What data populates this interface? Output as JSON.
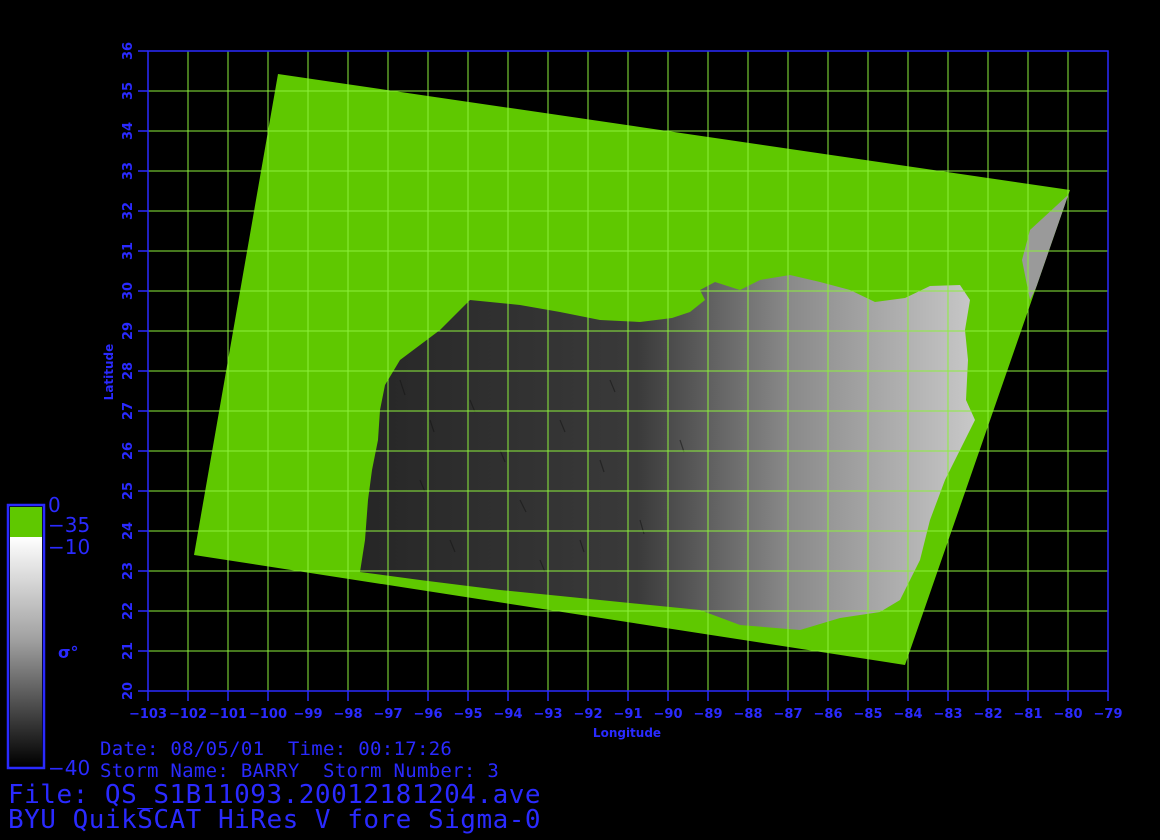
{
  "map": {
    "lon_ticks": [
      -103,
      -102,
      -101,
      -100,
      -99,
      -98,
      -97,
      -96,
      -95,
      -94,
      -93,
      -92,
      -91,
      -90,
      -89,
      -88,
      -87,
      -86,
      -85,
      -84,
      -83,
      -82,
      -81,
      -80,
      -79
    ],
    "lat_ticks": [
      20,
      21,
      22,
      23,
      24,
      25,
      26,
      27,
      28,
      29,
      30,
      31,
      32,
      33,
      34,
      35,
      36
    ],
    "lon_range": [
      -103,
      -79
    ],
    "lat_range": [
      20,
      36
    ],
    "xlabel": "Longitude",
    "ylabel": "Latitude",
    "axis_color": "#2a2aff",
    "grid_color": "#8cf03c",
    "land_color": "#5fc800"
  },
  "colorbar": {
    "top_label": "0",
    "land_label": "−35",
    "upper_label": "−10",
    "symbol": "σ°",
    "bottom_label": "−40"
  },
  "info": {
    "date_line": "Date: 08/05/01  Time: 00:17:26",
    "storm_line": "Storm Name: BARRY  Storm Number: 3",
    "file_line": "File: QS_S1B11093.20012181204.ave",
    "title_line": "BYU QuikSCAT HiRes V fore Sigma-0"
  }
}
